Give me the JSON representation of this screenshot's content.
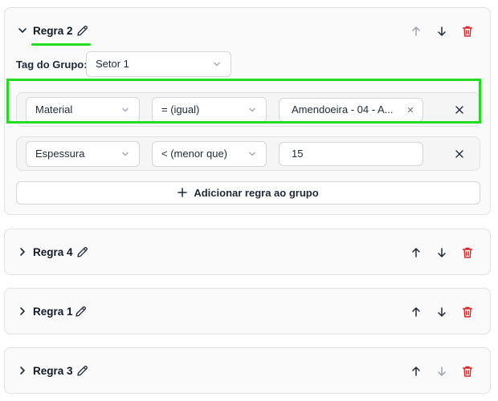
{
  "rules": [
    {
      "title": "Regra 2",
      "expanded": true,
      "group_tag_label": "Tag do Grupo:",
      "group_tag_value": "Setor 1",
      "conditions": [
        {
          "field": "Material",
          "operator": "= (igual)",
          "value": "Amendoeira - 04 - A...",
          "value_type": "chip"
        },
        {
          "field": "Espessura",
          "operator": "< (menor que)",
          "value": "15",
          "value_type": "text"
        }
      ],
      "add_rule_label": "Adicionar regra ao grupo",
      "move_up_enabled": false,
      "move_down_enabled": true
    },
    {
      "title": "Regra 4",
      "expanded": false,
      "move_up_enabled": true,
      "move_down_enabled": true
    },
    {
      "title": "Regra 1",
      "expanded": false,
      "move_up_enabled": true,
      "move_down_enabled": true
    },
    {
      "title": "Regra 3",
      "expanded": false,
      "move_up_enabled": true,
      "move_down_enabled": false
    }
  ],
  "colors": {
    "highlight": "#22dd22",
    "delete": "#dc2626",
    "icon_enabled": "#1f2937",
    "icon_disabled": "#9ca3af"
  },
  "icons": {
    "expand_expanded": "chevron-down-icon",
    "expand_collapsed": "chevron-right-icon",
    "edit": "pencil-icon",
    "move_up": "arrow-up-icon",
    "move_down": "arrow-down-icon",
    "delete": "trash-icon",
    "remove": "x-icon",
    "add": "plus-icon"
  }
}
